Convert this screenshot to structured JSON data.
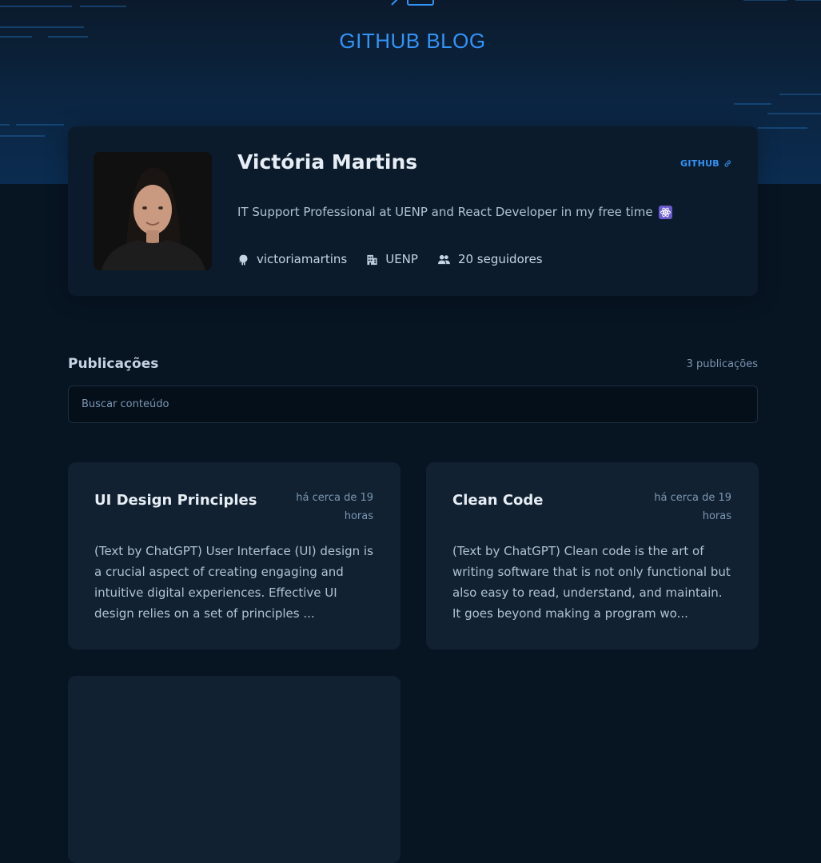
{
  "header": {
    "brand": "GITHUB BLOG",
    "logo_icon": "code-logo-icon"
  },
  "profile": {
    "name": "Victória Martins",
    "github_link": "GITHUB",
    "bio": "IT Support Professional at UENP and React Developer in my free time",
    "bio_icon": "atom-emoji-icon",
    "username": "victoriamartins",
    "company": "UENP",
    "followers": "20 seguidores"
  },
  "publications": {
    "title": "Publicações",
    "count": "3 publicações",
    "search_placeholder": "Buscar conteúdo",
    "posts": [
      {
        "title": "UI Design Principles",
        "date": "há cerca de 19 horas",
        "excerpt": "(Text by ChatGPT) User Interface (UI) design is a crucial aspect of creating engaging and intuitive digital experiences. Effective UI design relies on a set of principles ..."
      },
      {
        "title": "Clean Code",
        "date": "há cerca de 19 horas",
        "excerpt": "(Text by ChatGPT) Clean code is the art of writing software that is not only functional but also easy to read, understand, and maintain. It goes beyond making a program wo..."
      }
    ]
  },
  "colors": {
    "accent": "#3294F8",
    "background": "#071422",
    "card": "#112131",
    "profile": "#0B1B2B"
  }
}
